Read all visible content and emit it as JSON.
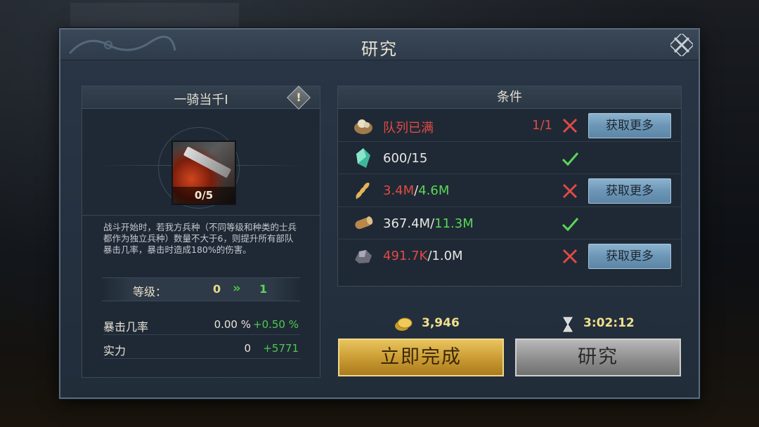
{
  "dialog": {
    "title": "研究"
  },
  "skill": {
    "name": "一骑当千I",
    "level_progress": "0/5",
    "description": "战斗开始时，若我方兵种（不同等级和种类的士兵都作为独立兵种）数量不大于6，则提升所有部队暴击几率，暴击时造成180%的伤害。",
    "level_label": "等级：",
    "level_from": "0",
    "level_to": "1",
    "stats": [
      {
        "name": "暴击几率",
        "current": "0.00 %",
        "bonus": "+0.50 %"
      },
      {
        "name": "实力",
        "current": "0",
        "bonus": "+5771"
      }
    ]
  },
  "conditions": {
    "title": "条件",
    "get_more_label": "获取更多",
    "rows": [
      {
        "icon": "queue-icon",
        "parts": [
          {
            "text": "队列已满",
            "color": "red"
          }
        ],
        "count": "1/1",
        "met": false
      },
      {
        "icon": "crystal-icon",
        "parts": [
          {
            "text": "600/15",
            "color": "white"
          }
        ],
        "count": "",
        "met": true
      },
      {
        "icon": "wheat-icon",
        "parts": [
          {
            "text": "3.4M",
            "color": "red"
          },
          {
            "text": "/",
            "color": "white"
          },
          {
            "text": "4.6M",
            "color": "green"
          }
        ],
        "count": "",
        "met": false
      },
      {
        "icon": "wood-icon",
        "parts": [
          {
            "text": "367.4M",
            "color": "white"
          },
          {
            "text": "/",
            "color": "white"
          },
          {
            "text": "11.3M",
            "color": "green"
          }
        ],
        "count": "",
        "met": true
      },
      {
        "icon": "ore-icon",
        "parts": [
          {
            "text": "491.7K",
            "color": "red"
          },
          {
            "text": "/1.0M",
            "color": "white"
          }
        ],
        "count": "",
        "met": false
      }
    ]
  },
  "costs": {
    "gold": "3,946",
    "time": "3:02:12"
  },
  "buttons": {
    "complete_now": "立即完成",
    "research": "研究"
  },
  "colors": {
    "red": "#e04a45",
    "green": "#5bd657",
    "gold_button": "#c99a32",
    "gray_button": "#8e8e8e",
    "get_more_button": "#6c96b6"
  }
}
